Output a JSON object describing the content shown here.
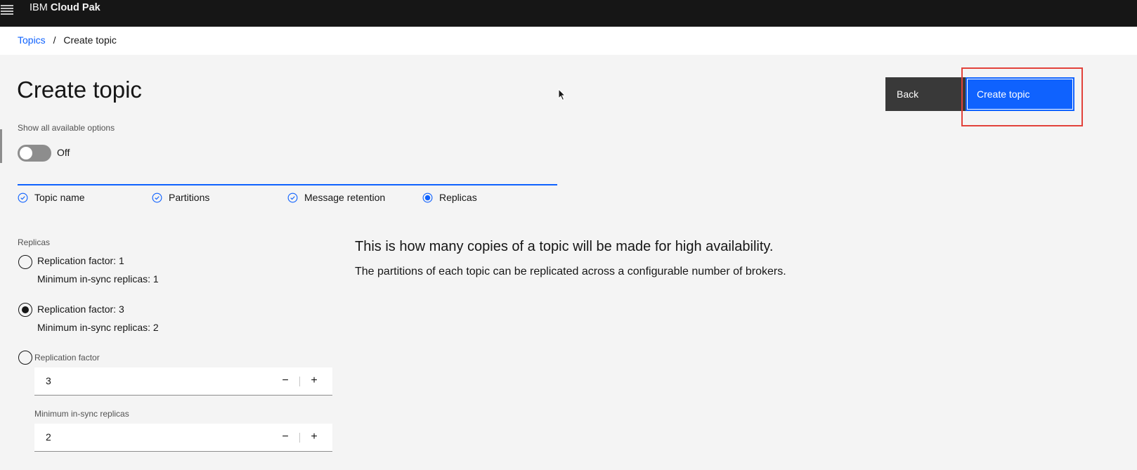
{
  "header": {
    "brand_prefix": "IBM",
    "brand_name": "Cloud Pak"
  },
  "breadcrumb": {
    "root": "Topics",
    "separator": "/",
    "current": "Create topic"
  },
  "page": {
    "title": "Create topic"
  },
  "actions": {
    "back_label": "Back",
    "create_label": "Create topic"
  },
  "options_toggle": {
    "label": "Show all available options",
    "state": "Off"
  },
  "steps": [
    {
      "label": "Topic name",
      "status": "complete"
    },
    {
      "label": "Partitions",
      "status": "complete"
    },
    {
      "label": "Message retention",
      "status": "complete"
    },
    {
      "label": "Replicas",
      "status": "current"
    }
  ],
  "replicas": {
    "label": "Replicas",
    "options": [
      {
        "line1": "Replication factor: 1",
        "line2": "Minimum in-sync replicas: 1",
        "selected": false
      },
      {
        "line1": "Replication factor: 3",
        "line2": "Minimum in-sync replicas: 2",
        "selected": true
      }
    ],
    "custom": {
      "replication_factor_label": "Replication factor",
      "replication_factor_value": "3",
      "min_insync_label": "Minimum in-sync replicas",
      "min_insync_value": "2",
      "minus_glyph": "−",
      "plus_glyph": "+"
    }
  },
  "description": {
    "title": "This is how many copies of a topic will be made for high availability.",
    "body": "The partitions of each topic can be replicated across a configurable number of brokers."
  },
  "colors": {
    "primary": "#0f62fe",
    "header_bg": "#161616",
    "highlight": "#e2423b"
  }
}
